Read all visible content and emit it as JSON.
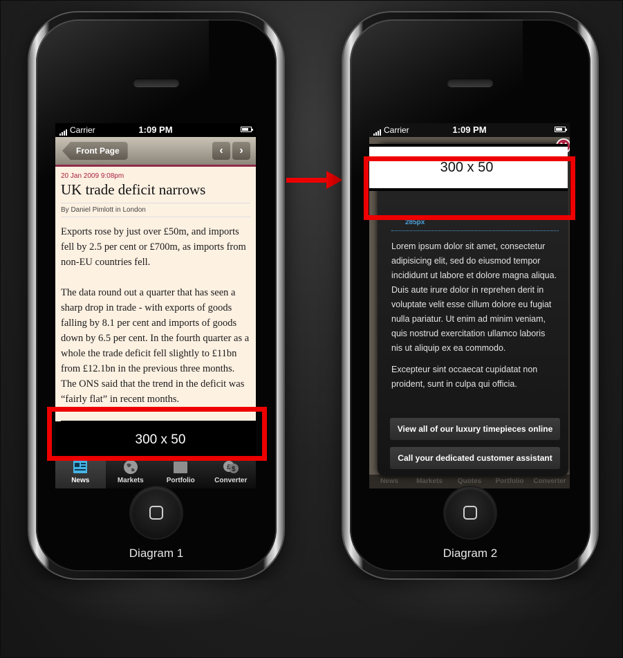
{
  "diagram1": {
    "status": {
      "carrier": "Carrier",
      "time": "1:09 PM"
    },
    "nav": {
      "back_label": "Front Page",
      "prev_glyph": "‹",
      "next_glyph": "›"
    },
    "article": {
      "dateline": "20 Jan 2009  9:08pm",
      "headline": "UK trade deficit narrows",
      "byline": "By Daniel Pimlott in London",
      "paragraphs": [
        "Exports rose by just over £50m, and imports fell by 2.5 per cent or £700m, as imports from non-EU countries fell.",
        "The data round out a quarter that has seen a sharp drop in trade - with exports of goods falling by 8.1 per cent and imports of goods down by 6.5 per cent. In the fourth quarter as a whole the trade deficit fell slightly to £11bn from £12.1bn in the previous three months. The ONS said that the trend in the deficit was “fairly flat” in recent months."
      ]
    },
    "ad_label": "300 x 50",
    "tabs": [
      {
        "label": "News",
        "icon": "newspaper-icon"
      },
      {
        "label": "Markets",
        "icon": "globe-icon"
      },
      {
        "label": "Portfolio",
        "icon": "folder-icon"
      },
      {
        "label": "Converter",
        "icon": "currency-icon"
      }
    ],
    "caption": "Diagram 1"
  },
  "diagram2": {
    "status": {
      "carrier": "Carrier",
      "time": "1:09 PM"
    },
    "ad_label": "300 x 50",
    "close_glyph": "✕",
    "dimension_label": "285px",
    "lorem": [
      "Lorem ipsum dolor sit amet, consectetur adipisicing elit, sed do eiusmod tempor incididunt ut labore et dolore magna aliqua. Duis aute irure dolor in reprehen derit in voluptate velit esse cillum dolore eu fugiat nulla pariatur. Ut enim ad minim veniam, quis nostrud exercitation ullamco laboris nis ut aliquip ex ea commodo.",
      "Excepteur sint occaecat cupidatat non proident, sunt in culpa qui officia."
    ],
    "cta": [
      "View all of our luxury timepieces online",
      "Call your dedicated customer assistant"
    ],
    "background_tabs": [
      "News",
      "Markets",
      "Quotes",
      "Portfolio",
      "Converter"
    ],
    "caption": "Diagram 2"
  },
  "colors": {
    "highlight": "#ee0000",
    "accent": "#a81f3d",
    "dimension": "#4da0d8"
  }
}
